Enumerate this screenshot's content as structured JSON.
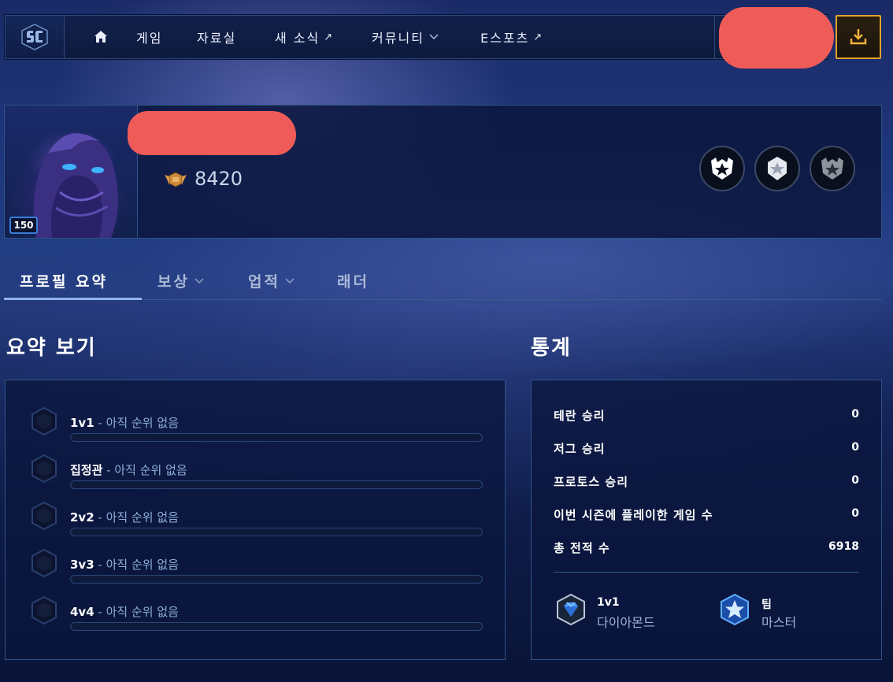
{
  "nav": {
    "items": [
      {
        "label": "게임",
        "type": "plain"
      },
      {
        "label": "자료실",
        "type": "plain"
      },
      {
        "label": "새 소식",
        "type": "external"
      },
      {
        "label": "커뮤니티",
        "type": "dropdown"
      },
      {
        "label": "E스포츠",
        "type": "external"
      }
    ],
    "external_glyph": "↗",
    "icons": [
      "starcraft-logo-icon",
      "home-icon",
      "download-icon"
    ],
    "accent_color": "#e0a32a"
  },
  "profile": {
    "level": "150",
    "achievement_points": "8420",
    "badges": [
      "achievement-badge-1-icon",
      "achievement-badge-2-icon",
      "achievement-badge-3-icon"
    ]
  },
  "tabs": [
    {
      "label": "프로필 요약",
      "active": true,
      "dropdown": false
    },
    {
      "label": "보상",
      "active": false,
      "dropdown": true
    },
    {
      "label": "업적",
      "active": false,
      "dropdown": true
    },
    {
      "label": "래더",
      "active": false,
      "dropdown": false
    }
  ],
  "summary": {
    "title": "요약 보기",
    "rows": [
      {
        "mode": "1v1",
        "separator": " - ",
        "status": "아직 순위 없음"
      },
      {
        "mode": "집정관",
        "separator": " - ",
        "status": "아직 순위 없음"
      },
      {
        "mode": "2v2",
        "separator": " - ",
        "status": "아직 순위 없음"
      },
      {
        "mode": "3v3",
        "separator": " - ",
        "status": "아직 순위 없음"
      },
      {
        "mode": "4v4",
        "separator": " - ",
        "status": "아직 순위 없음"
      }
    ]
  },
  "stats": {
    "title": "통계",
    "rows": [
      {
        "label": "테란 승리",
        "value": "0"
      },
      {
        "label": "저그 승리",
        "value": "0"
      },
      {
        "label": "프로토스 승리",
        "value": "0"
      },
      {
        "label": "이번 시즌에 플레이한 게임 수",
        "value": "0"
      },
      {
        "label": "총 전적 수",
        "value": "6918"
      }
    ],
    "ranks": [
      {
        "mode": "1v1",
        "tier": "다이아몬드",
        "icon": "diamond-league-icon"
      },
      {
        "mode": "팀",
        "tier": "마스터",
        "icon": "master-league-icon"
      }
    ]
  }
}
